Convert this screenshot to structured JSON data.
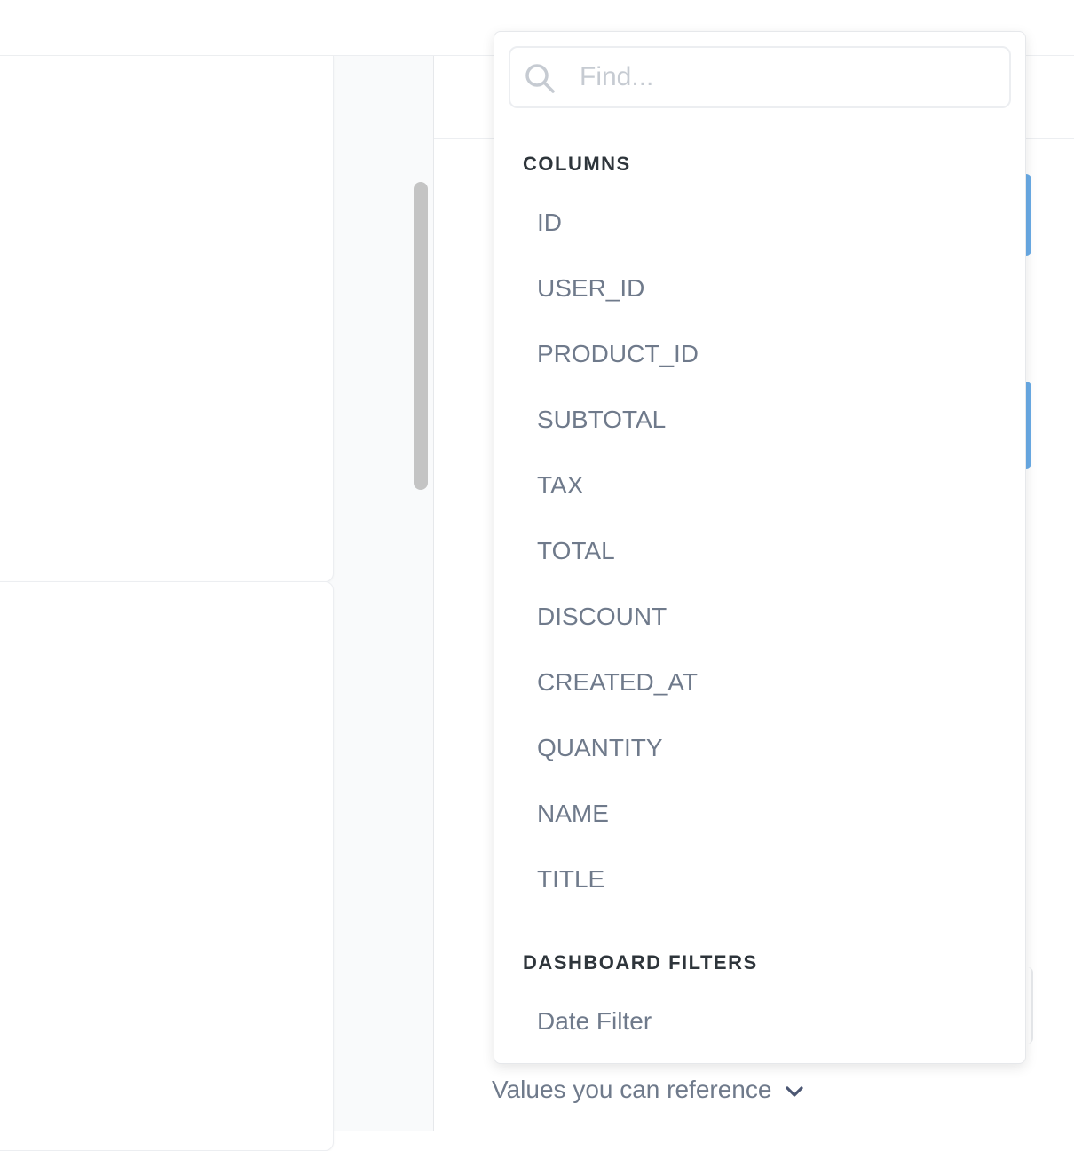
{
  "search": {
    "placeholder": "Find..."
  },
  "sections": {
    "columns_title": "COLUMNS",
    "filters_title": "DASHBOARD FILTERS"
  },
  "columns": [
    "ID",
    "USER_ID",
    "PRODUCT_ID",
    "SUBTOTAL",
    "TAX",
    "TOTAL",
    "DISCOUNT",
    "CREATED_AT",
    "QUANTITY",
    "NAME",
    "TITLE"
  ],
  "filters": [
    "Date Filter"
  ],
  "footer": {
    "values_reference_label": "Values you can reference"
  },
  "icons": {
    "search": "search-icon",
    "chevron": "chevron-down-icon"
  },
  "colors": {
    "accent": "#509ee3",
    "item_text": "#6f7a8b",
    "header_text": "#2e353b"
  }
}
